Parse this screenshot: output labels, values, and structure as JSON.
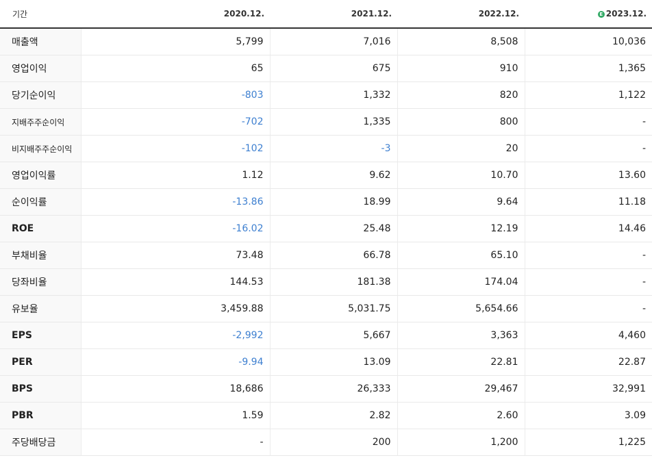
{
  "header": {
    "label": "기간",
    "periods": [
      "2020.12.",
      "2021.12.",
      "2022.12.",
      "2023.12."
    ],
    "estimate_badge": "E"
  },
  "colors": {
    "negative": "#3d7fd0",
    "estimate_badge": "#33aa66"
  },
  "rows": [
    {
      "label": "매출액",
      "values": [
        "5,799",
        "7,016",
        "8,508",
        "10,036"
      ]
    },
    {
      "label": "영업이익",
      "values": [
        "65",
        "675",
        "910",
        "1,365"
      ]
    },
    {
      "label": "당기순이익",
      "values": [
        "-803",
        "1,332",
        "820",
        "1,122"
      ]
    },
    {
      "label": "지배주주순이익",
      "values": [
        "-702",
        "1,335",
        "800",
        "-"
      ]
    },
    {
      "label": "비지배주주순이익",
      "values": [
        "-102",
        "-3",
        "20",
        "-"
      ]
    },
    {
      "label": "영업이익률",
      "values": [
        "1.12",
        "9.62",
        "10.70",
        "13.60"
      ]
    },
    {
      "label": "순이익률",
      "values": [
        "-13.86",
        "18.99",
        "9.64",
        "11.18"
      ]
    },
    {
      "label": "ROE",
      "values": [
        "-16.02",
        "25.48",
        "12.19",
        "14.46"
      ]
    },
    {
      "label": "부채비율",
      "values": [
        "73.48",
        "66.78",
        "65.10",
        "-"
      ]
    },
    {
      "label": "당좌비율",
      "values": [
        "144.53",
        "181.38",
        "174.04",
        "-"
      ]
    },
    {
      "label": "유보율",
      "values": [
        "3,459.88",
        "5,031.75",
        "5,654.66",
        "-"
      ]
    },
    {
      "label": "EPS",
      "values": [
        "-2,992",
        "5,667",
        "3,363",
        "4,460"
      ]
    },
    {
      "label": "PER",
      "values": [
        "-9.94",
        "13.09",
        "22.81",
        "22.87"
      ]
    },
    {
      "label": "BPS",
      "values": [
        "18,686",
        "26,333",
        "29,467",
        "32,991"
      ]
    },
    {
      "label": "PBR",
      "values": [
        "1.59",
        "2.82",
        "2.60",
        "3.09"
      ]
    },
    {
      "label": "주당배당금",
      "values": [
        "-",
        "200",
        "1,200",
        "1,225"
      ]
    }
  ]
}
